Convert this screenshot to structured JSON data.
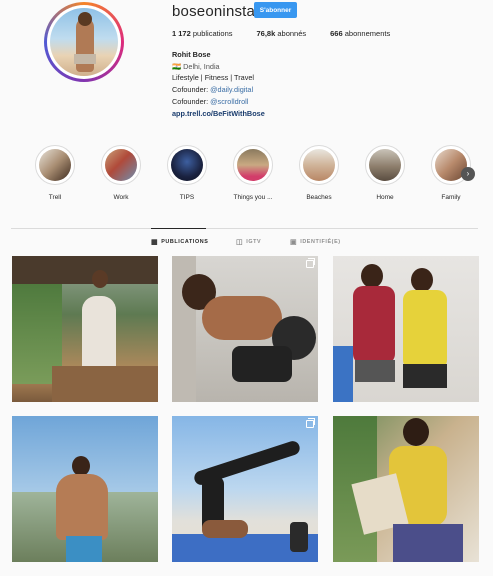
{
  "profile": {
    "username": "boseoninsta",
    "follow_label": "S'abonner",
    "stats": {
      "posts_count": "1 172",
      "posts_label": "publications",
      "followers_count": "76,8k",
      "followers_label": "abonnés",
      "following_count": "666",
      "following_label": "abonnements"
    },
    "bio": {
      "name": "Rohit Bose",
      "location": "🇮🇳 Delhi, India",
      "line1": "Lifestyle | Fitness | Travel",
      "cofounder1_prefix": "Cofounder: ",
      "cofounder1_handle": "@daily.digital",
      "cofounder2_prefix": "Cofounder: ",
      "cofounder2_handle": "@scrolldroll",
      "link": "app.trell.co/BeFitWithBose"
    }
  },
  "highlights": [
    {
      "label": "Trell"
    },
    {
      "label": "Work"
    },
    {
      "label": "TIPS"
    },
    {
      "label": "Things you ..."
    },
    {
      "label": "Beaches"
    },
    {
      "label": "Home"
    },
    {
      "label": "Family"
    }
  ],
  "tabs": [
    {
      "label": "PUBLICATIONS",
      "icon": "grid-icon",
      "glyph": "▦",
      "active": true
    },
    {
      "label": "IGTV",
      "icon": "igtv-icon",
      "glyph": "◫",
      "active": false
    },
    {
      "label": "IDENTIFIÉ(E)",
      "icon": "tagged-icon",
      "glyph": "▣",
      "active": false
    }
  ],
  "colors": {
    "follow_button": "#3897f0",
    "link": "#1b3d6e",
    "mention": "#3b6ea5"
  }
}
